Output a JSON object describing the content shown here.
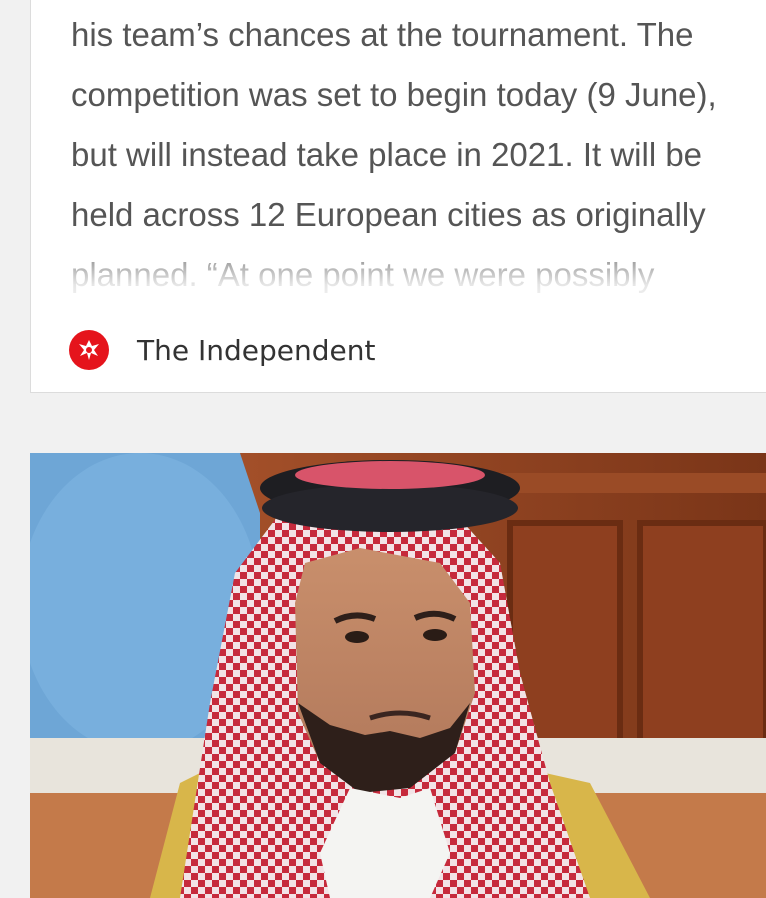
{
  "article": {
    "excerpt": "his team’s chances at the tournament. The competition was set to begin today (9 June), but will instead take place in 2021. It will be held across 12 European cities as originally planned. “At one point we were possibly looking at being",
    "source_name": "The Independent"
  },
  "colors": {
    "source_logo": "#e5141c",
    "page_background": "#f1f1f1"
  },
  "icons": {
    "source_logo": "independent-eagle-logo-icon"
  }
}
